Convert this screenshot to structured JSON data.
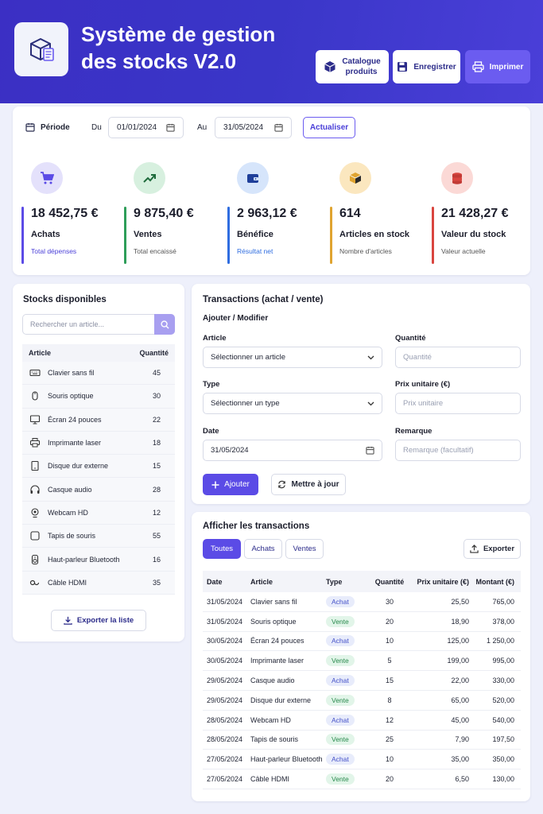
{
  "header": {
    "title": "Système de gestion des stocks V2.0",
    "buttons": {
      "catalogue": "Catalogue produits",
      "save": "Enregistrer",
      "print": "Imprimer"
    }
  },
  "period": {
    "label": "Période",
    "from_label": "Du",
    "from_value": "01/01/2024",
    "to_label": "Au",
    "to_value": "31/05/2024",
    "refresh": "Actualiser"
  },
  "kpis": [
    {
      "value": "18 452,75 €",
      "label": "Achats",
      "sub": "Total dépenses",
      "icon": "cart-icon",
      "bg": "#f1f0fd",
      "accent": "#5b4be6"
    },
    {
      "value": "9 875,40 €",
      "label": "Ventes",
      "sub": "Total encaissé",
      "icon": "trend-up-icon",
      "bg": "#eef8f1",
      "accent": "#2f9e5a"
    },
    {
      "value": "2 963,12 €",
      "label": "Bénéfice",
      "sub": "Résultat net",
      "icon": "wallet-icon",
      "bg": "#ecf3fd",
      "accent": "#2f6de0"
    },
    {
      "value": "614",
      "label": "Articles en stock",
      "sub": "Nombre d'articles",
      "icon": "box-icon",
      "bg": "#fdf6e9",
      "accent": "#e0a430"
    },
    {
      "value": "21 428,27 €",
      "label": "Valeur du stock",
      "sub": "Valeur actuelle",
      "icon": "coins-icon",
      "bg": "#fdf0ef",
      "accent": "#d9453f"
    }
  ],
  "stocks": {
    "title": "Stocks disponibles",
    "search_placeholder": "Rechercher un article...",
    "col_article": "Article",
    "col_qty": "Quantité",
    "items": [
      {
        "name": "Clavier sans fil",
        "qty": "45",
        "icon": "keyboard-icon"
      },
      {
        "name": "Souris optique",
        "qty": "30",
        "icon": "mouse-icon"
      },
      {
        "name": "Écran 24 pouces",
        "qty": "22",
        "icon": "monitor-icon"
      },
      {
        "name": "Imprimante laser",
        "qty": "18",
        "icon": "printer-icon"
      },
      {
        "name": "Disque dur externe",
        "qty": "15",
        "icon": "hard-drive-icon"
      },
      {
        "name": "Casque audio",
        "qty": "28",
        "icon": "headphones-icon"
      },
      {
        "name": "Webcam HD",
        "qty": "12",
        "icon": "webcam-icon"
      },
      {
        "name": "Tapis de souris",
        "qty": "55",
        "icon": "mousepad-icon"
      },
      {
        "name": "Haut-parleur Bluetooth",
        "qty": "16",
        "icon": "speaker-icon"
      },
      {
        "name": "Câble HDMI",
        "qty": "35",
        "icon": "cable-icon"
      }
    ],
    "export": "Exporter la liste"
  },
  "transactions_form": {
    "title": "Transactions (achat / vente)",
    "subtitle": "Ajouter / Modifier",
    "article_label": "Article",
    "article_value": "Sélectionner un article",
    "qty_label": "Quantité",
    "qty_placeholder": "Quantité",
    "type_label": "Type",
    "type_value": "Sélectionner un type",
    "price_label": "Prix unitaire (€)",
    "price_placeholder": "Prix unitaire",
    "date_label": "Date",
    "date_value": "31/05/2024",
    "remark_label": "Remarque",
    "remark_placeholder": "Remarque (facultatif)",
    "add": "Ajouter",
    "update": "Mettre à jour"
  },
  "transactions_list": {
    "title": "Afficher les transactions",
    "tabs": [
      "Toutes",
      "Achats",
      "Ventes"
    ],
    "export": "Exporter",
    "columns": [
      "Date",
      "Article",
      "Type",
      "Quantité",
      "Prix unitaire (€)",
      "Montant (€)"
    ],
    "rows": [
      {
        "date": "31/05/2024",
        "article": "Clavier sans fil",
        "type": "Achat",
        "qty": "30",
        "pu": "25,50",
        "mt": "765,00"
      },
      {
        "date": "31/05/2024",
        "article": "Souris optique",
        "type": "Vente",
        "qty": "20",
        "pu": "18,90",
        "mt": "378,00"
      },
      {
        "date": "30/05/2024",
        "article": "Écran 24 pouces",
        "type": "Achat",
        "qty": "10",
        "pu": "125,00",
        "mt": "1 250,00"
      },
      {
        "date": "30/05/2024",
        "article": "Imprimante laser",
        "type": "Vente",
        "qty": "5",
        "pu": "199,00",
        "mt": "995,00"
      },
      {
        "date": "29/05/2024",
        "article": "Casque audio",
        "type": "Achat",
        "qty": "15",
        "pu": "22,00",
        "mt": "330,00"
      },
      {
        "date": "29/05/2024",
        "article": "Disque dur externe",
        "type": "Vente",
        "qty": "8",
        "pu": "65,00",
        "mt": "520,00"
      },
      {
        "date": "28/05/2024",
        "article": "Webcam HD",
        "type": "Achat",
        "qty": "12",
        "pu": "45,00",
        "mt": "540,00"
      },
      {
        "date": "28/05/2024",
        "article": "Tapis de souris",
        "type": "Vente",
        "qty": "25",
        "pu": "7,90",
        "mt": "197,50"
      },
      {
        "date": "27/05/2024",
        "article": "Haut-parleur Bluetooth",
        "type": "Achat",
        "qty": "10",
        "pu": "35,00",
        "mt": "350,00"
      },
      {
        "date": "27/05/2024",
        "article": "Câble HDMI",
        "type": "Vente",
        "qty": "20",
        "pu": "6,50",
        "mt": "130,00"
      }
    ]
  }
}
